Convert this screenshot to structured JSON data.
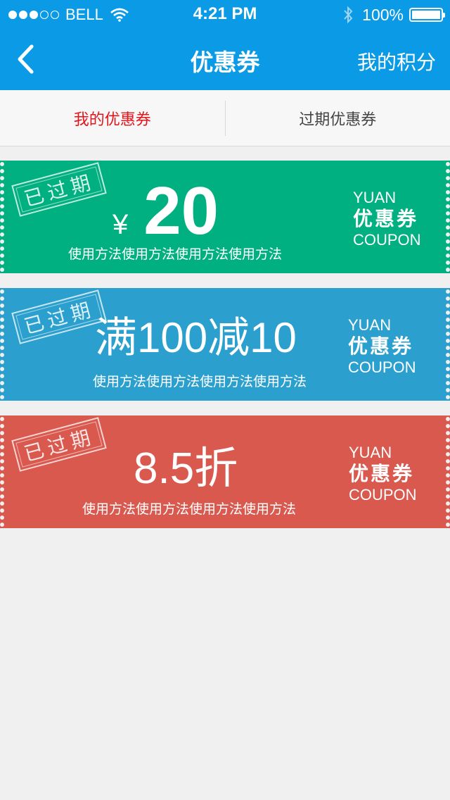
{
  "status_bar": {
    "carrier": "BELL",
    "time": "4:21 PM",
    "battery": "100%",
    "signal_dots": [
      true,
      true,
      true,
      false,
      false
    ]
  },
  "nav": {
    "back_icon": "chevron-left-icon",
    "title": "优惠券",
    "right_label": "我的积分"
  },
  "tabs": [
    {
      "label": "我的优惠券",
      "active": true
    },
    {
      "label": "过期优惠券",
      "active": false
    }
  ],
  "coupons": [
    {
      "color": "#00b080",
      "stamp": "已过期",
      "currency": "¥",
      "value": "20",
      "desc": "使用方法使用方法使用方法使用方法",
      "side_top": "YUAN",
      "side_mid": "优惠券",
      "side_bottom": "COUPON"
    },
    {
      "color": "#2b9fcd",
      "stamp": "已过期",
      "value": "满100减10",
      "desc": "使用方法使用方法使用方法使用方法",
      "side_top": "YUAN",
      "side_mid": "优惠券",
      "side_bottom": "COUPON"
    },
    {
      "color": "#d9594f",
      "stamp": "已过期",
      "value": "8.5折",
      "desc": "使用方法使用方法使用方法使用方法",
      "side_top": "YUAN",
      "side_mid": "优惠券",
      "side_bottom": "COUPON"
    }
  ],
  "colors": {
    "header": "#0b9ae6",
    "tab_active": "#e3141b",
    "background": "#f0f0f0"
  }
}
